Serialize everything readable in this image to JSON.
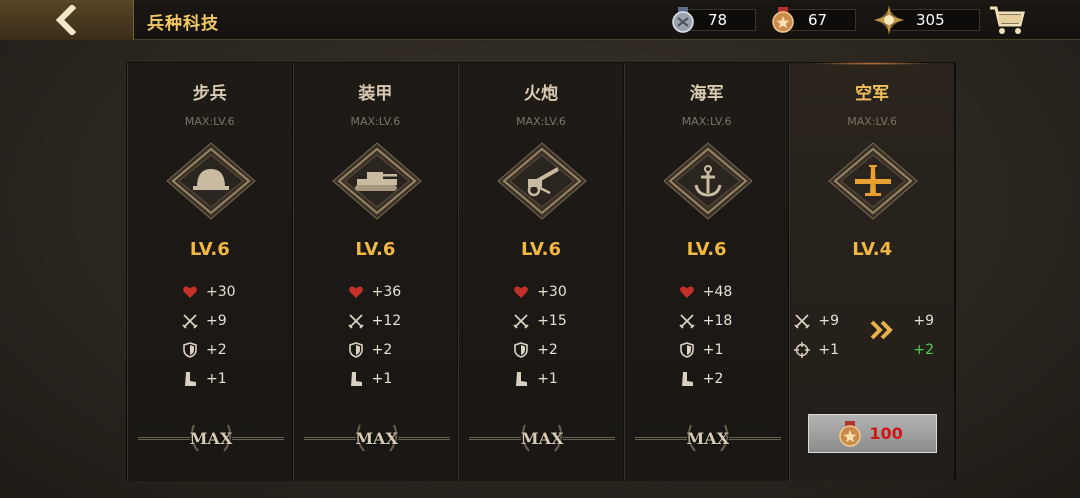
{
  "header": {
    "title": "兵种科技",
    "currencies": [
      {
        "icon": "silver-medal-icon",
        "value": "78"
      },
      {
        "icon": "bronze-medal-icon",
        "value": "67"
      },
      {
        "icon": "gold-star-icon",
        "value": "305"
      }
    ]
  },
  "cards": [
    {
      "name": "步兵",
      "max_level": "MAX:LV.6",
      "icon": "helmet-icon",
      "level": "LV.6",
      "stats": [
        "+30",
        "+9",
        "+2",
        "+1"
      ],
      "status": "MAX"
    },
    {
      "name": "装甲",
      "max_level": "MAX:LV.6",
      "icon": "tank-icon",
      "level": "LV.6",
      "stats": [
        "+36",
        "+12",
        "+2",
        "+1"
      ],
      "status": "MAX"
    },
    {
      "name": "火炮",
      "max_level": "MAX:LV.6",
      "icon": "artillery-icon",
      "level": "LV.6",
      "stats": [
        "+30",
        "+15",
        "+2",
        "+1"
      ],
      "status": "MAX"
    },
    {
      "name": "海军",
      "max_level": "MAX:LV.6",
      "icon": "anchor-icon",
      "level": "LV.6",
      "stats": [
        "+48",
        "+18",
        "+1",
        "+2"
      ],
      "status": "MAX"
    },
    {
      "name": "空军",
      "max_level": "MAX:LV.6",
      "icon": "airplane-icon",
      "level": "LV.4",
      "upgrade": {
        "attack_current": "+9",
        "attack_next": "+9",
        "accuracy_current": "+1",
        "accuracy_next": "+2"
      },
      "upgrade_cost": "100"
    }
  ],
  "colors": {
    "accent_gold": "#f0b743",
    "title_gold": "#f1c866",
    "increase_green": "#4fd14a",
    "cost_red": "#d01515"
  }
}
